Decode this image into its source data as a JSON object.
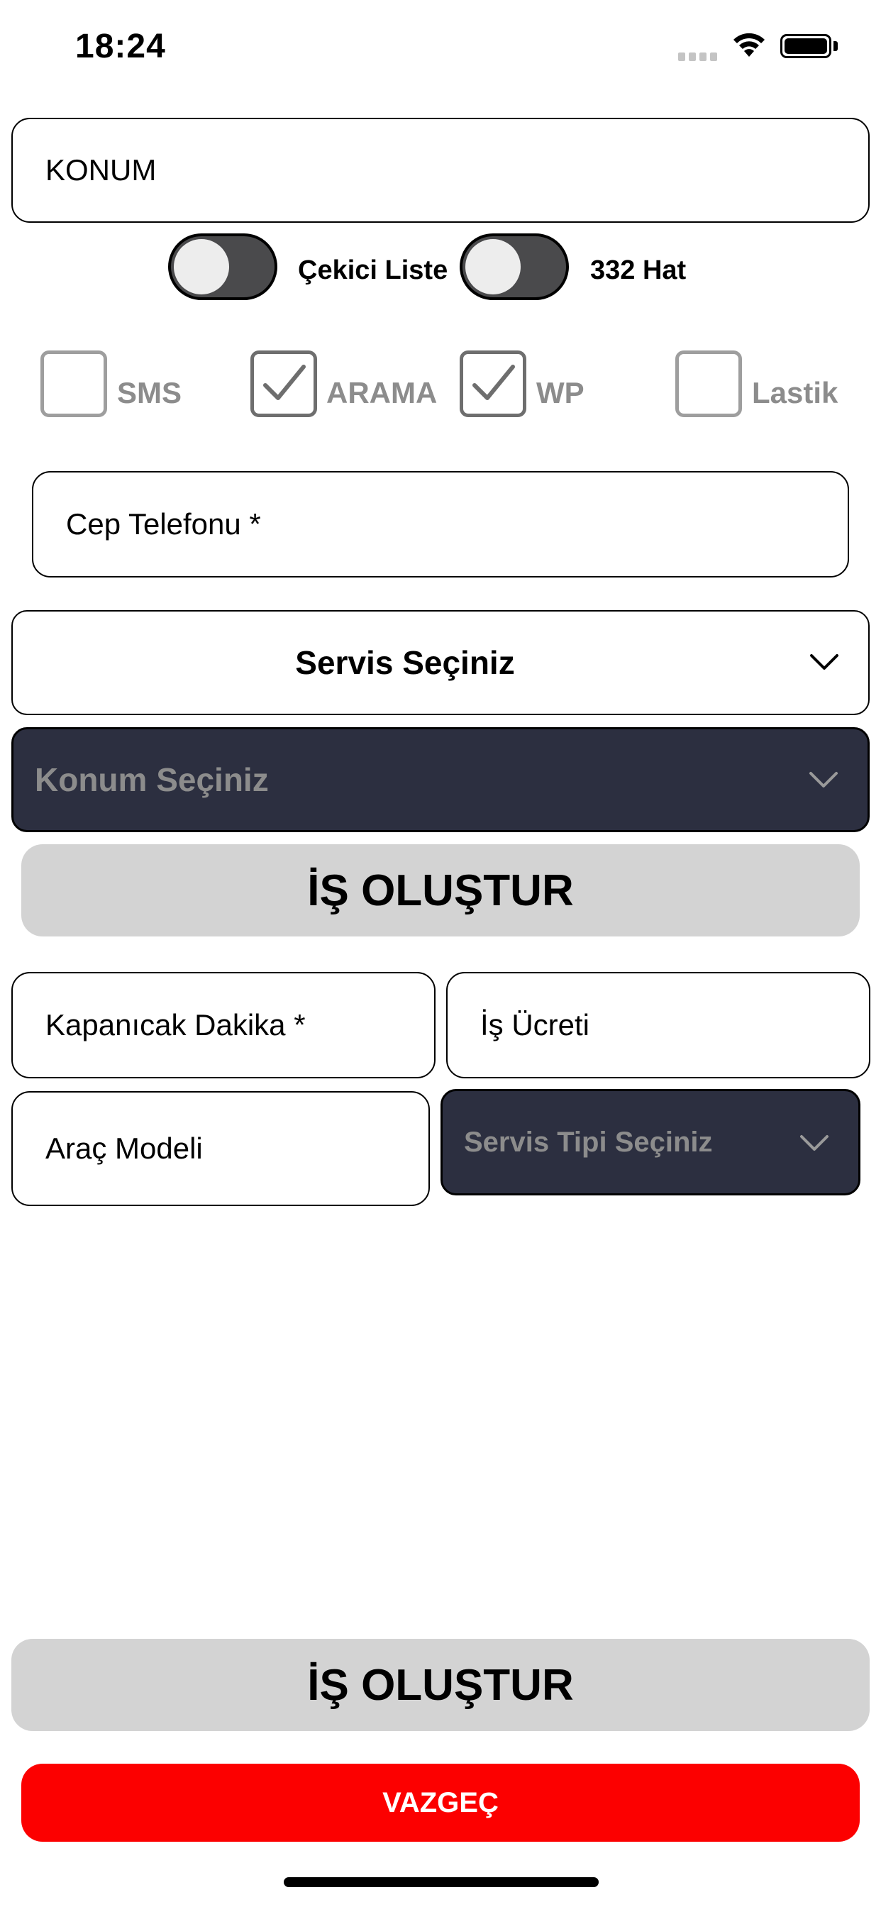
{
  "status_bar": {
    "time": "18:24"
  },
  "location_field": {
    "value": "KONUM"
  },
  "toggles": [
    {
      "label": "Çekici Liste",
      "on": false
    },
    {
      "label": "332 Hat",
      "on": false
    }
  ],
  "checkboxes": [
    {
      "label": "SMS",
      "checked": false
    },
    {
      "label": "ARAMA",
      "checked": true
    },
    {
      "label": "WP",
      "checked": true
    },
    {
      "label": "Lastik",
      "checked": false
    }
  ],
  "phone_field": {
    "placeholder": "Cep Telefonu *"
  },
  "service_select": {
    "value": "Servis Seçiniz"
  },
  "location_select": {
    "value": "Konum Seçiniz"
  },
  "create_button_top": {
    "label": "İŞ OLUŞTUR"
  },
  "close_minutes_field": {
    "placeholder": "Kapanıcak Dakika *"
  },
  "job_fee_field": {
    "placeholder": "İş Ücreti"
  },
  "vehicle_model_field": {
    "placeholder": "Araç Modeli"
  },
  "service_type_select": {
    "value": "Servis Tipi Seçiniz"
  },
  "create_button_bottom": {
    "label": "İŞ OLUŞTUR"
  },
  "cancel_button": {
    "label": "VAZGEÇ"
  },
  "colors": {
    "dark_select_bg": "#2c2f40",
    "grey_button_bg": "#d3d3d3",
    "cancel_bg": "#fc0000",
    "toggle_track": "#4a4a4c"
  }
}
